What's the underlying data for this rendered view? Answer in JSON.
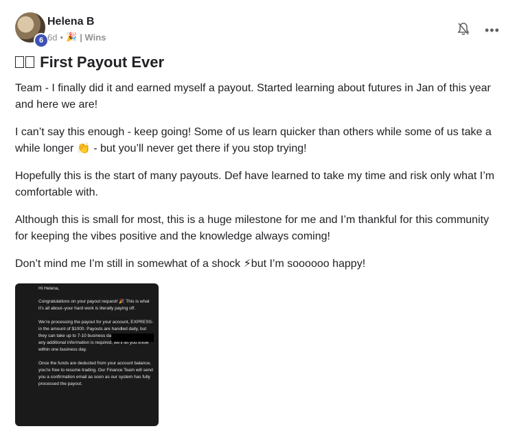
{
  "post": {
    "author": "Helena B",
    "level": "6",
    "time": "6d",
    "category": "| Wins",
    "title_icon_glyph": "▯▯",
    "title": "First Payout Ever",
    "paragraphs": [
      "Team - I finally did it and earned myself a payout. Started learning about futures in Jan of this year and here we are!",
      "I can’t say this enough - keep going! Some of us learn quicker than others while some of us take a while longer 👏 - but you’ll never get there if you stop trying!",
      "Hopefully this is the start of many payouts. Def have learned to take my time and risk only what I’m comfortable with.",
      "Although this is small for most, this is a huge milestone for me and I’m thankful for this community for keeping the vibes positive and the knowledge always coming!",
      "Don’t mind me I’m still in somewhat of a shock ⚡but I’m soooooo happy!"
    ]
  },
  "screenshot": {
    "greeting": "Hi Helena,",
    "lines": [
      "Congratulations on your payout request! 🎉 This is what it’s all about–your hard work is literally paying off.",
      "We’re processing the payout for your account, EXPRESS-",
      "in the amount of $1000. Payouts are handled daily, but they can take up to 7-10 business days to reach you. If any additional information is required, we’ll let you know within one business day.",
      "Once the funds are deducted from your account balance, you’re free to resume trading. Our Finance Team will send you a confirmation email as soon as our system has fully processed the payout."
    ]
  },
  "icons": {
    "bell": "bell-slash-icon",
    "more": "more-dots-icon",
    "category": "party-popper-icon"
  },
  "colors": {
    "badge": "#3f51b5",
    "meta": "#909090",
    "text": "#202124"
  }
}
